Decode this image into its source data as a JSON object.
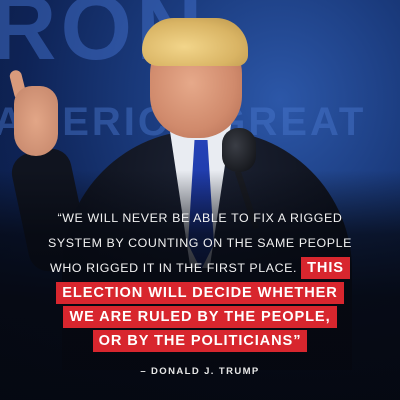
{
  "background": {
    "top_letters": "RON",
    "banner_words": "AMERICA GREAT",
    "colors": {
      "stage_blue": "#1a3a7c",
      "highlight_red": "#d8262e",
      "text_white": "#f2f2f2"
    }
  },
  "quote": {
    "line1": "“WE WILL NEVER BE ABLE TO FIX A RIGGED",
    "line2": "SYSTEM BY COUNTING ON THE SAME PEOPLE",
    "line3_plain": "WHO RIGGED IT IN THE FIRST PLACE.",
    "line3_highlight": "THIS",
    "line4_highlight": "ELECTION WILL DECIDE WHETHER",
    "line5_highlight": "WE ARE RULED BY THE PEOPLE,",
    "line6_highlight": "OR BY THE POLITICIANS”"
  },
  "attribution": "– DONALD J. TRUMP"
}
